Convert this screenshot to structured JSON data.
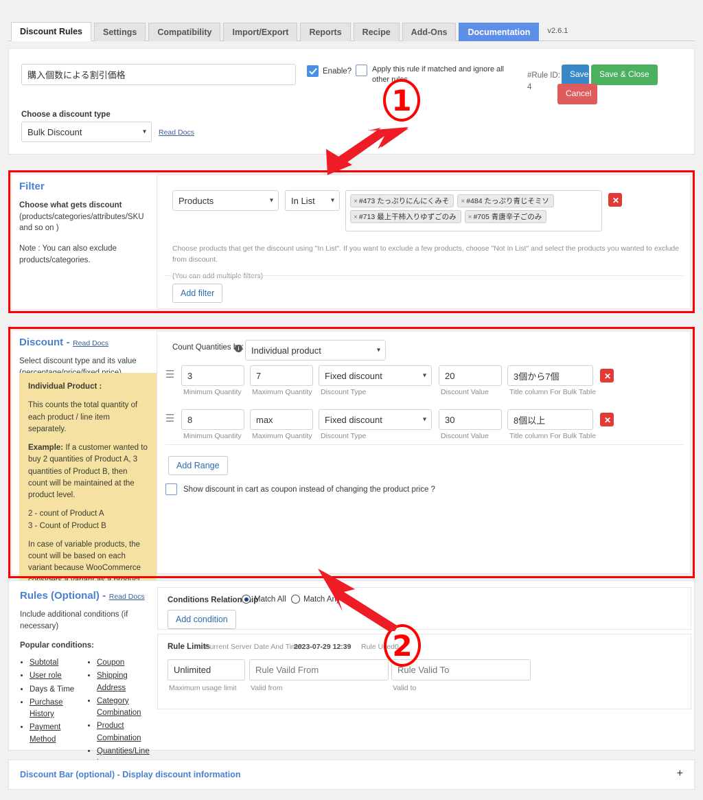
{
  "tabs": [
    {
      "label": "Discount Rules",
      "state": "active"
    },
    {
      "label": "Settings",
      "state": "normal"
    },
    {
      "label": "Compatibility",
      "state": "normal"
    },
    {
      "label": "Import/Export",
      "state": "normal"
    },
    {
      "label": "Reports",
      "state": "normal"
    },
    {
      "label": "Recipe",
      "state": "normal"
    },
    {
      "label": "Add-Ons",
      "state": "normal"
    },
    {
      "label": "Documentation",
      "state": "highlight"
    }
  ],
  "version": "v2.6.1",
  "rule_header": {
    "title_value": "購入個数による割引価格",
    "enable_label": "Enable?",
    "enable_checked": true,
    "apply_label": "Apply this rule if matched and ignore all other rules",
    "apply_checked": false,
    "rule_id_label": "#Rule ID:",
    "rule_id_value": "4",
    "save_label": "Save",
    "save_close_label": "Save & Close",
    "cancel_label": "Cancel",
    "discount_type_label": "Choose a discount type",
    "discount_type_value": "Bulk Discount",
    "read_docs": "Read Docs"
  },
  "filter": {
    "title": "Filter",
    "desc_bold": "Choose what gets discount",
    "desc_rest": "(products/categories/attributes/SKU and so on )",
    "note": "Note : You can also exclude products/categories.",
    "subject_value": "Products",
    "operator_value": "In List",
    "tags": [
      "#473 たっぷりにんにくみそ",
      "#484 たっぷり青じそミソ",
      "#713 最上干柿入りゆずごのみ",
      "#705 青唐辛子ごのみ"
    ],
    "help_line1": "Choose products that get the discount using \"In List\". If you want to exclude a few products, choose \"Not In List\" and select the products you wanted to exclude from discount.",
    "help_line2": "(You can add multiple filters)",
    "add_filter_label": "Add filter",
    "delete_icon": "✕"
  },
  "discount": {
    "title": "Discount",
    "title_dash": "-",
    "read_docs": "Read Docs",
    "desc": "Select discount type and its value (percentage/price/fixed price)",
    "note_heading": "Individual Product :",
    "note_p1": "This counts the total quantity of each product / line item separately.",
    "note_p2_bold": "Example:",
    "note_p2": " If a customer wanted to buy 2 quantities of Product A, 3 quantities of Product B, then count will be maintained at the product level.",
    "note_p3a": "2 - count of Product A",
    "note_p3b": "3 - Count of Product B",
    "note_p4": "In case of variable products, the count will be based on each variant because WooCommerce considers a variant as a product itself.",
    "count_by_label": "Count Quantities by:",
    "count_by_value": "Individual product",
    "col_labels": {
      "min": "Minimum Quantity",
      "max": "Maximum Quantity",
      "type": "Discount Type",
      "value": "Discount Value",
      "title": "Title column For Bulk Table"
    },
    "rows": [
      {
        "min": "3",
        "max": "7",
        "type": "Fixed discount",
        "value": "20",
        "title": "3個から7個"
      },
      {
        "min": "8",
        "max": "max",
        "type": "Fixed discount",
        "value": "30",
        "title": "8個以上"
      }
    ],
    "add_range_label": "Add Range",
    "coupon_checkbox_label": "Show discount in cart as coupon instead of changing the product price ?",
    "coupon_checked": false
  },
  "rules": {
    "title": "Rules (Optional)",
    "title_dash": "-",
    "read_docs": "Read Docs",
    "desc": "Include additional conditions (if necessary)",
    "popular_heading": "Popular conditions:",
    "conditions_left": [
      "Subtotal",
      "User role",
      "Days & Time",
      "Purchase History",
      "Payment Method"
    ],
    "conditions_right": [
      "Coupon",
      "Shipping Address",
      "Category Combination",
      "Product Combination",
      "Quantities/Line items"
    ],
    "relationship_label": "Conditions Relationship",
    "match_all_label": "Match All",
    "match_any_label": "Match Any",
    "match_selected": "Match All",
    "add_condition_label": "Add condition",
    "limits_label": "Rule Limits",
    "server_time_label": "Current Server Date And Time:",
    "server_time_value": "2023-07-29 12:39",
    "rule_used_label": "Rule Used:",
    "rule_used_value": "0",
    "usage_limit_value": "Unlimited",
    "valid_from_placeholder": "Rule Vaild From",
    "valid_to_placeholder": "Rule Valid To",
    "usage_limit_caption": "Maximum usage limit",
    "valid_from_caption": "Valid from",
    "valid_to_caption": "Valid to"
  },
  "discount_bar": {
    "title": "Discount Bar (optional) - Display discount information",
    "expand_icon": "+"
  },
  "annotations": {
    "badge1": "1",
    "badge2": "2"
  },
  "colors": {
    "accent_blue": "#4a7fd4",
    "tab_highlight": "#5d8fe8",
    "save": "#3a87c8",
    "save_close": "#4cb05e",
    "cancel": "#e05b5b",
    "annotation_red": "#ff0000",
    "note_yellow": "#f5e2a3"
  }
}
